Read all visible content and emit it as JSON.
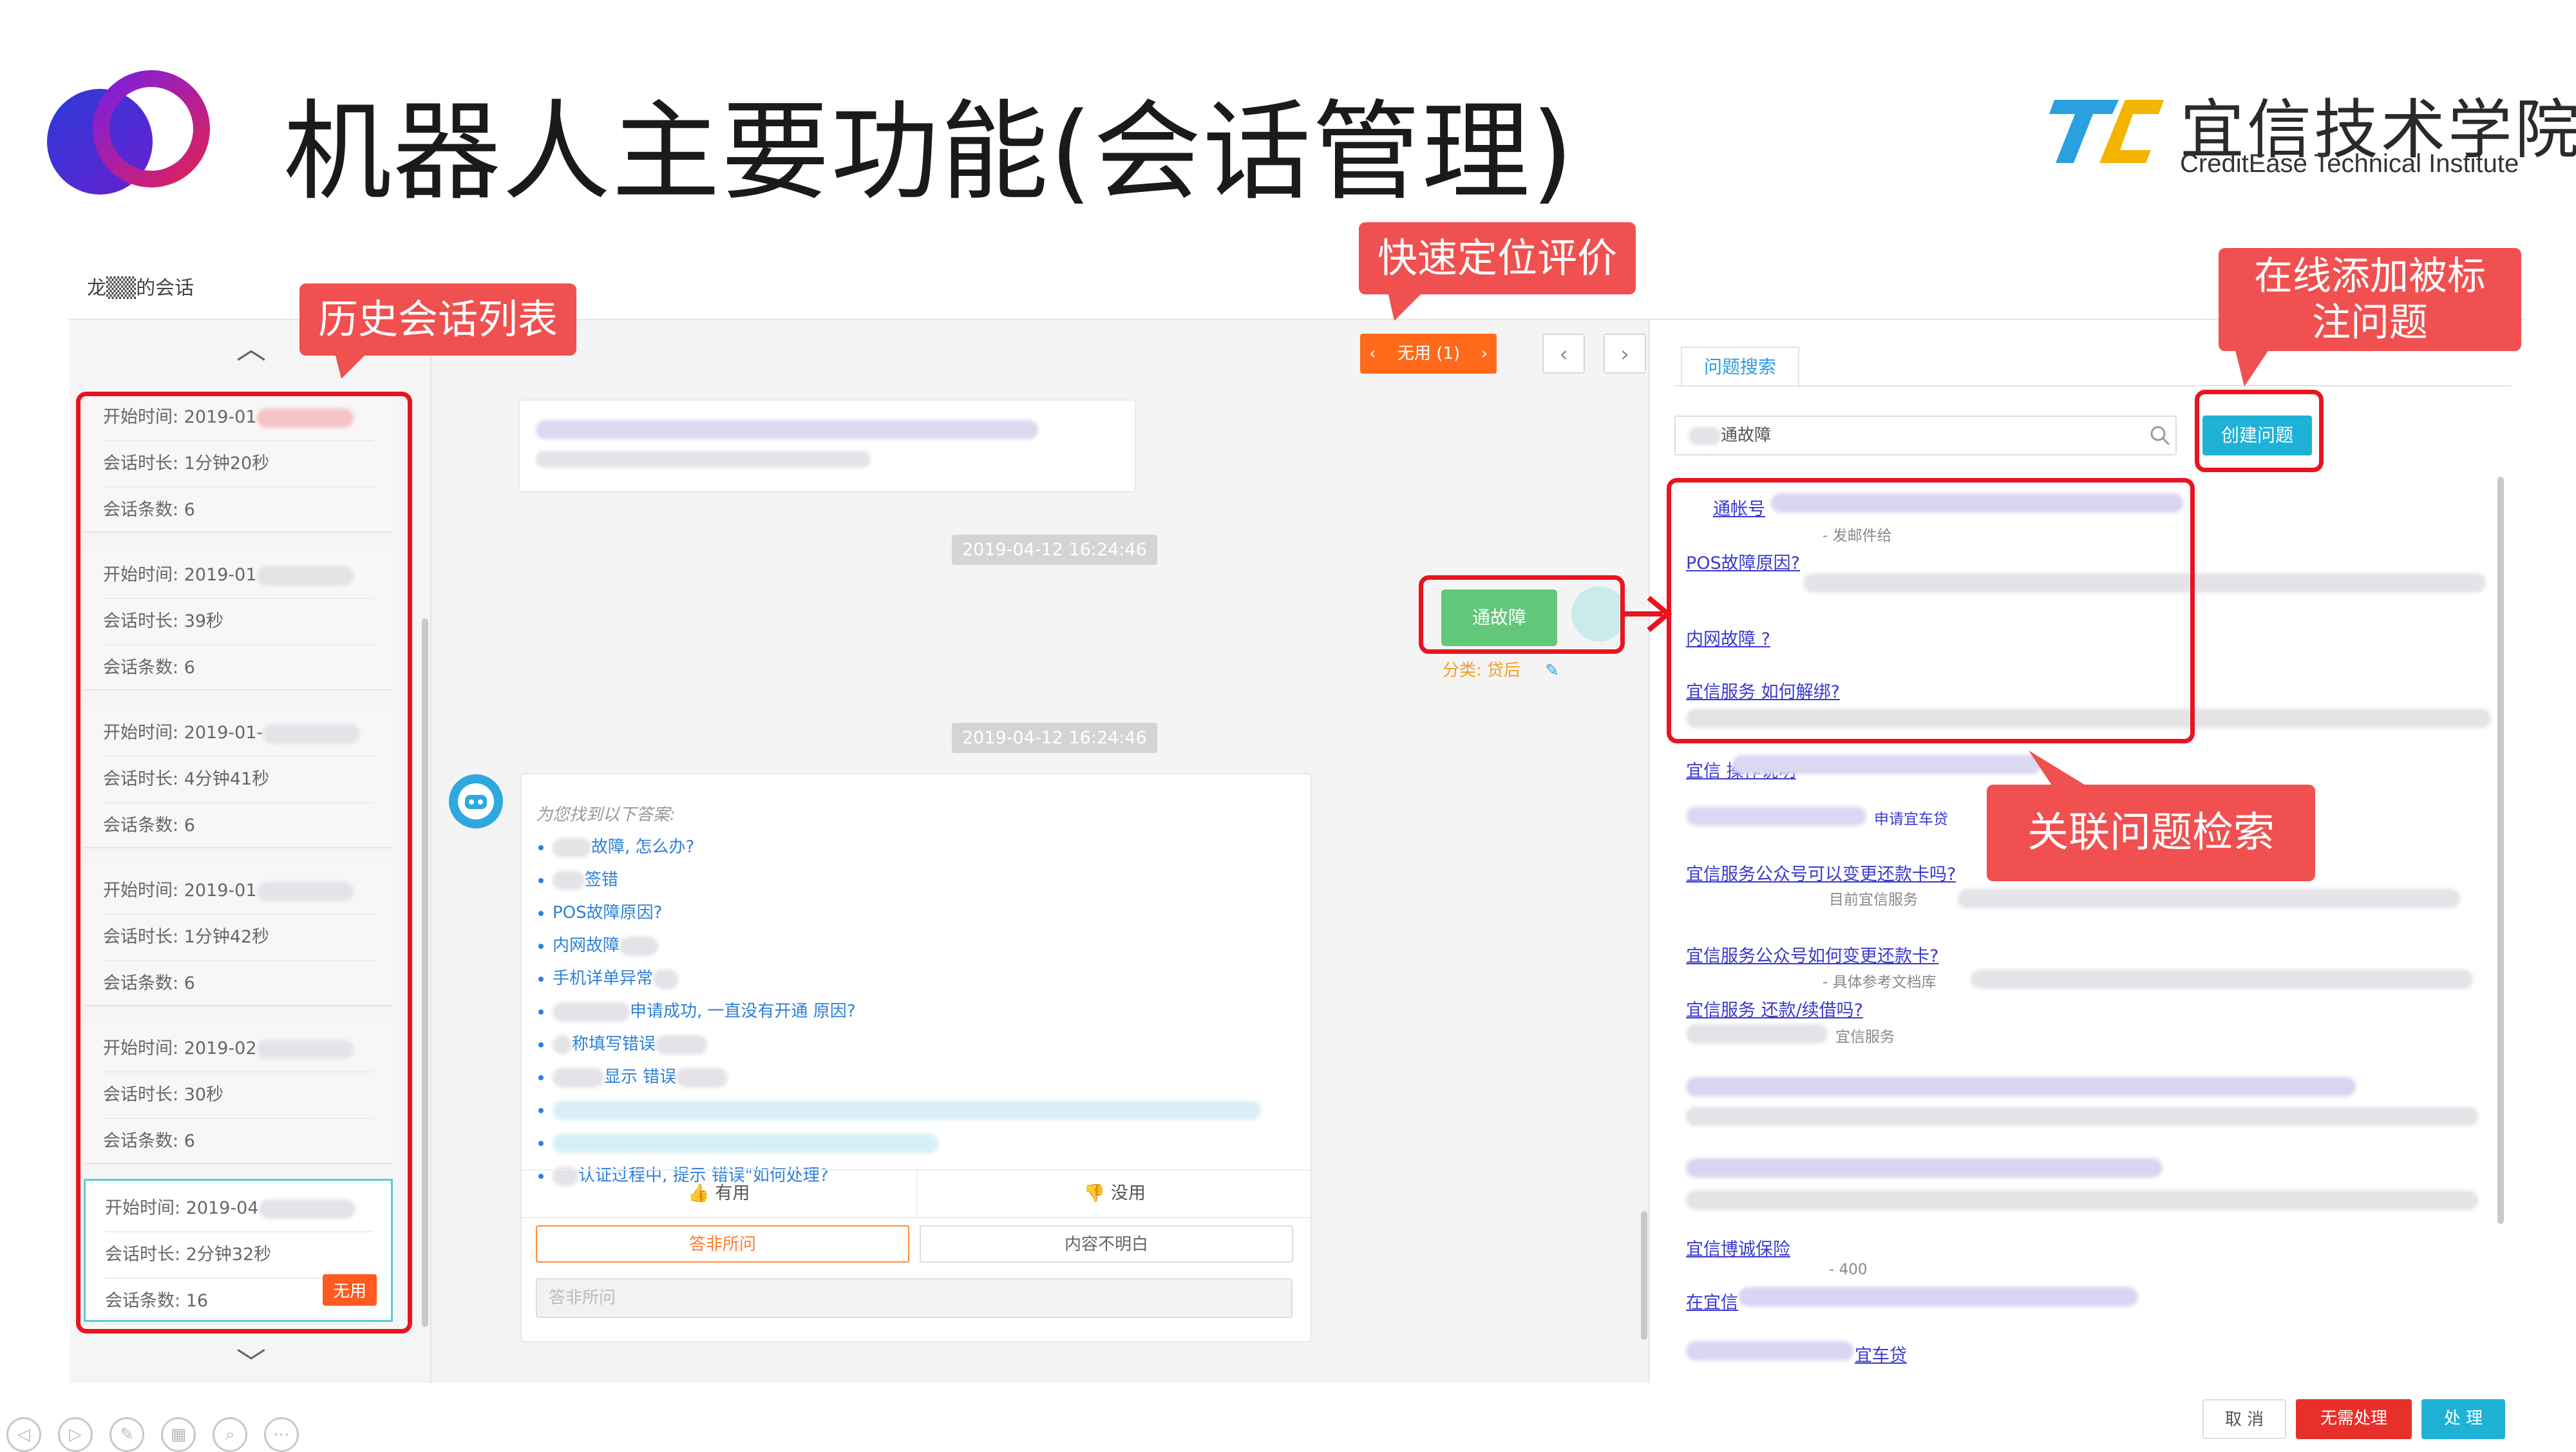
{
  "header": {
    "title": "机器人主要功能(会话管理)",
    "brand_cn": "宜信技术学院",
    "brand_en": "CreditEase Technical Institute"
  },
  "conversation": {
    "title": "龙▒▒的会话"
  },
  "sessions": {
    "labels": {
      "start": "开始时间: ",
      "duration": "会话时长: ",
      "count": "会话条数: "
    },
    "items": [
      {
        "start": "2019-01",
        "duration": "1分钟20秒",
        "count": "6"
      },
      {
        "start": "2019-01",
        "duration": "39秒",
        "count": "6"
      },
      {
        "start": "2019-01-",
        "duration": "4分钟41秒",
        "count": "6"
      },
      {
        "start": "2019-01",
        "duration": "1分钟42秒",
        "count": "6"
      },
      {
        "start": "2019-02",
        "duration": "30秒",
        "count": "6"
      },
      {
        "start": "2019-04",
        "duration": "2分钟32秒",
        "count": "16",
        "tag": "无用"
      }
    ]
  },
  "toolbar": {
    "rating_filter": "无用 (1)",
    "prev": "‹",
    "next": "›",
    "left_arrow": "‹",
    "right_arrow": "›"
  },
  "chat": {
    "timestamp1": "2019-04-12 16:24:46",
    "timestamp2": "2019-04-12 16:24:46",
    "user_message": "通故障",
    "category_label": "分类: 贷后",
    "bot_intro": "为您找到以下答案:",
    "bot_items": [
      "故障, 怎么办?",
      "签错",
      "POS故障原因?",
      "内网故障",
      "手机详单异常",
      "申请成功, 一直没有开通 原因?",
      "称填写错误",
      "显示 错误",
      "",
      "",
      "认证过程中, 提示 错误\"如何处理?"
    ],
    "feedback_useful": "有用",
    "feedback_useless": "没用",
    "option_irrelevant": "答非所问",
    "option_unclear": "内容不明白",
    "input_placeholder": "答非所问"
  },
  "right": {
    "tab": "问题搜索",
    "search_value": "通故障",
    "create_button": "创建问题",
    "results": [
      {
        "title": "通帐号",
        "sub": "- 发邮件给"
      },
      {
        "title": "POS故障原因?",
        "sub": ""
      },
      {
        "title": "内网故障 ?",
        "sub": ""
      },
      {
        "title": "宜信服务 如何解绑?",
        "sub": ""
      },
      {
        "title": "宜信 操作说明",
        "sub": "申请宜车贷"
      },
      {
        "title": "宜信服务公众号可以变更还款卡吗?",
        "sub": "目前宜信服务"
      },
      {
        "title": "宜信服务公众号如何变更还款卡?",
        "sub": "- 具体参考文档库"
      },
      {
        "title": "宜信服务 还款/续借吗?",
        "sub": "宜信服务"
      },
      {
        "title": "宜信博诚保险",
        "sub": "- 400"
      },
      {
        "title": "在宜信",
        "sub": ""
      },
      {
        "title": "宜车贷",
        "sub": ""
      }
    ],
    "footer_cancel": "取 消",
    "footer_no_action": "无需处理",
    "footer_process": "处 理"
  },
  "annotations": {
    "history_list": "历史会话列表",
    "quick_locate": "快速定位评价",
    "online_add": "在线添加被标注问题",
    "related_search": "关联问题检索"
  },
  "colors": {
    "annotation_red": "#e8141f",
    "annotation_label_bg": "#f05050",
    "accent_cyan": "#1fb2d6",
    "useless_orange": "#ff5a1f",
    "user_bubble_green": "#62c77a",
    "link_blue": "#3a3ad0"
  }
}
